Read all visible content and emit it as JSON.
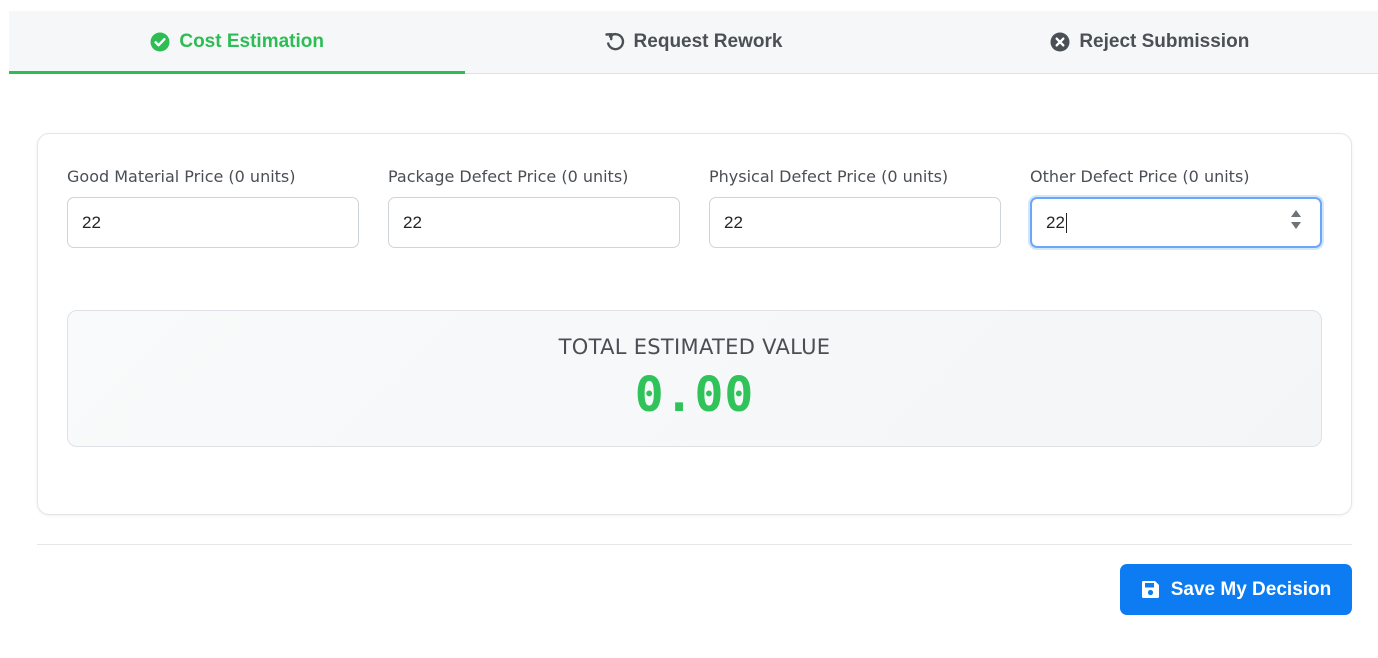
{
  "tabs": [
    {
      "label": "Cost Estimation",
      "icon": "check-circle-icon",
      "active": true
    },
    {
      "label": "Request Rework",
      "icon": "undo-icon",
      "active": false
    },
    {
      "label": "Reject Submission",
      "icon": "x-circle-icon",
      "active": false
    }
  ],
  "colors": {
    "accent_green": "#2dbd55",
    "primary_blue": "#0d7cf2"
  },
  "fields": [
    {
      "label": "Good Material Price (0 units)",
      "value": "22"
    },
    {
      "label": "Package Defect Price (0 units)",
      "value": "22"
    },
    {
      "label": "Physical Defect Price (0 units)",
      "value": "22"
    },
    {
      "label": "Other Defect Price (0 units)",
      "value": "22",
      "focused": true
    }
  ],
  "total": {
    "label": "TOTAL ESTIMATED VALUE",
    "value": "0.00"
  },
  "actions": {
    "save_label": "Save My Decision",
    "save_icon": "floppy-disk-icon"
  }
}
